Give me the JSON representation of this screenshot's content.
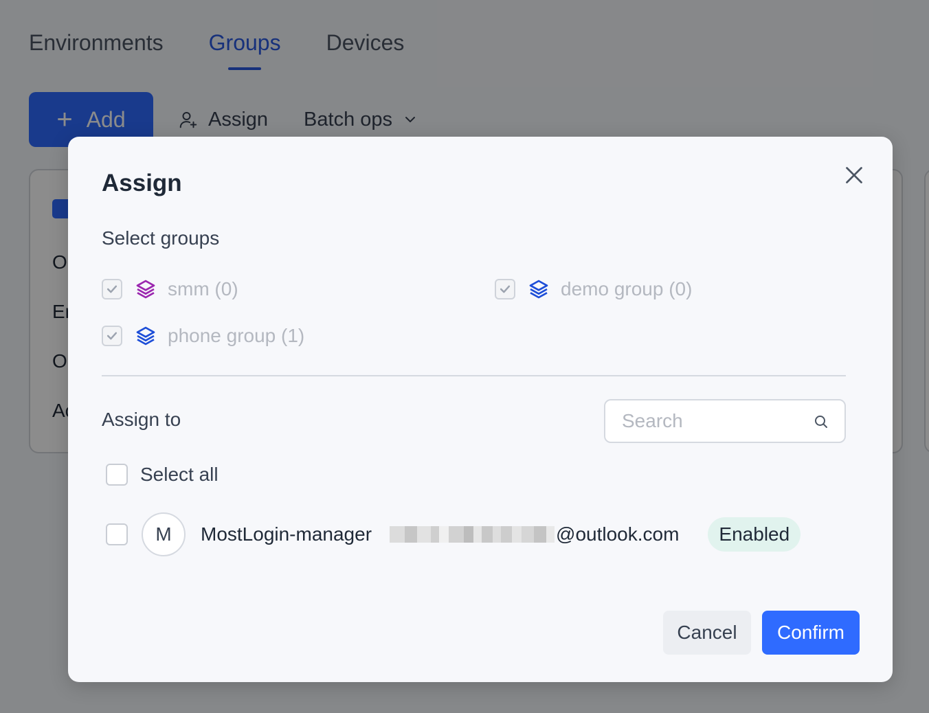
{
  "background": {
    "tabs": [
      {
        "label": "Environments",
        "active": false
      },
      {
        "label": "Groups",
        "active": true
      },
      {
        "label": "Devices",
        "active": false
      }
    ],
    "toolbar": {
      "add_label": "Add",
      "assign_label": "Assign",
      "batch_label": "Batch ops"
    },
    "card_partial_lines": [
      "O",
      "Er",
      "O",
      "Ac"
    ]
  },
  "modal": {
    "title": "Assign",
    "select_groups_label": "Select groups",
    "groups": [
      {
        "label": "smm (0)",
        "checked": true,
        "disabled": true,
        "icon": "layers-icon",
        "color": "#9b27af"
      },
      {
        "label": "demo group (0)",
        "checked": true,
        "disabled": true,
        "icon": "layers-icon",
        "color": "#1d4ed8"
      },
      {
        "label": "phone group (1)",
        "checked": true,
        "disabled": true,
        "icon": "layers-icon",
        "color": "#1d4ed8"
      }
    ],
    "assign_to_label": "Assign to",
    "search": {
      "placeholder": "Search",
      "value": ""
    },
    "select_all_label": "Select all",
    "users": [
      {
        "avatar_letter": "M",
        "name": "MostLogin-manager",
        "email_suffix": "@outlook.com",
        "status": "Enabled",
        "checked": false
      }
    ],
    "cancel_label": "Cancel",
    "confirm_label": "Confirm"
  },
  "colors": {
    "accent": "#2f6bff",
    "badge_bg": "#e1f3ee",
    "group_smm": "#9b27af",
    "group_blue": "#1d4ed8"
  }
}
